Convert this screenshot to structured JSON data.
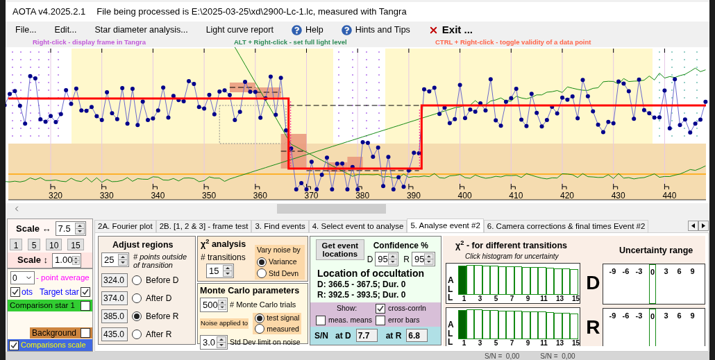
{
  "window": {
    "app_version": "AOTA v4.2025.2.1",
    "file_info": "File being processed is E:\\2025-03-25\\xd\\2900-Lc-1.lc, measured with Tangra"
  },
  "menu": [
    {
      "label": "File...",
      "kind": "plain"
    },
    {
      "label": "Edit...",
      "kind": "plain"
    },
    {
      "label": "Star diameter analysis...",
      "kind": "plain"
    },
    {
      "label": "Light curve report",
      "kind": "plain"
    },
    {
      "label": "Help",
      "kind": "help"
    },
    {
      "label": "Hints and Tips",
      "kind": "help"
    },
    {
      "label": "Exit ...",
      "kind": "exit"
    }
  ],
  "hints": [
    {
      "text": "Right-click  -  display frame in Tangra",
      "color": "#c058d8"
    },
    {
      "text": "ALT + Right-click  -  set full light level",
      "color": "#2e8b57"
    },
    {
      "text": "CTRL + Right-click  -  toggle validity of a data point",
      "color": "#ff6347"
    }
  ],
  "plot": {
    "x_tick_labels": [
      "320",
      "330",
      "340",
      "350",
      "360",
      "370",
      "380",
      "390",
      "400",
      "410",
      "420",
      "430",
      "440"
    ]
  },
  "scale_panel": {
    "horizontal": {
      "label": "Scale ↔",
      "value": "7.5"
    },
    "presets": [
      "1",
      "5",
      "10",
      "15"
    ],
    "vertical": {
      "label": "Scale ↕",
      "value": "1.00"
    }
  },
  "series_panel": {
    "average": {
      "value": "0",
      "label": "- point average"
    },
    "series": [
      {
        "kind": "target",
        "prefix_label": "ots",
        "prefix_checked": true,
        "label": "Target star",
        "checked": true,
        "color": "#0000ff"
      },
      {
        "kind": "comparison",
        "label": "Comparison star 1",
        "checked": false,
        "color": "#32cd32"
      },
      {
        "kind": "background",
        "label": "Background",
        "checked": false,
        "color": "#cd853f"
      },
      {
        "kind": "scaled",
        "label": "Comparisons scale",
        "checked": true,
        "color": "#4169e1"
      }
    ]
  },
  "tabs": [
    {
      "label": "2A. Fourier plot",
      "selected": false
    },
    {
      "label": "2B. [1, 2 & 3] - frame test",
      "selected": false
    },
    {
      "label": "3. Find events",
      "selected": false
    },
    {
      "label": "4. Select event to analyse",
      "selected": false
    },
    {
      "label": "5. Analyse event #2",
      "selected": true
    },
    {
      "label": "6. Camera corrections & final times Event #2",
      "selected": false
    }
  ],
  "adjust_regions": {
    "title": "Adjust regions",
    "points": {
      "value": "25",
      "label": "# points outside of transition"
    },
    "regions": [
      {
        "value": "324.0",
        "label": "Before D",
        "selected": false
      },
      {
        "value": "374.0",
        "label": "After D",
        "selected": false
      },
      {
        "value": "385.0",
        "label": "Before R",
        "selected": true
      },
      {
        "value": "435.0",
        "label": "After R",
        "selected": false
      }
    ]
  },
  "chi2_analysis": {
    "title": "χ$^{2}$ analysis",
    "transitions": {
      "label": "# transitions",
      "value": "15"
    },
    "vary_noise": {
      "title": "Vary noise by",
      "options": [
        {
          "label": "Variance",
          "selected": true
        },
        {
          "label": "Std Devn",
          "selected": false
        }
      ]
    }
  },
  "monte_carlo": {
    "title": "Monte Carlo parameters",
    "trials": {
      "value": "500",
      "label": "# Monte Carlo trials"
    },
    "noise_applied_label": "Noise applied to",
    "noise_options": [
      {
        "label": "test signal",
        "selected": true
      },
      {
        "label": "measured",
        "selected": false
      }
    ],
    "std_dev": {
      "value": "3.0",
      "label": "Std Dev limit on noise"
    }
  },
  "event_locations": {
    "button": "Get event locations",
    "confidence": {
      "title": "Confidence %",
      "d": {
        "label": "D",
        "value": "95"
      },
      "r": {
        "label": "R",
        "value": "95"
      }
    },
    "location_title": "Location of occultation",
    "lines": [
      "D: 366.5 - 367.5; Dur. 0",
      "R: 392.5 - 393.5; Dur. 0"
    ],
    "show": {
      "title": "Show:",
      "options": [
        {
          "label": "cross-corrln",
          "checked": true
        },
        {
          "label": "meas. means",
          "checked": false
        },
        {
          "label": "error bars",
          "checked": false
        }
      ]
    },
    "sn": {
      "label": "S/N",
      "d_label": "at D",
      "d_value": "7.7",
      "r_label": "at R",
      "r_value": "6.8"
    }
  },
  "transitions_chart": {
    "title": "χ$^{2}$ - for different transitions",
    "subtitle": "Click histogram for uncertainty",
    "histograms": [
      {
        "side_label": "ALL",
        "letter": "D",
        "bar_labels": [
          "1",
          "3",
          "5",
          "7",
          "9",
          "11",
          "13",
          "15"
        ]
      },
      {
        "side_label": "ALL",
        "letter": "R",
        "bar_labels": [
          "1",
          "3",
          "5",
          "7",
          "9",
          "11",
          "13",
          "15"
        ]
      }
    ]
  },
  "uncertainty": {
    "title": "Uncertainty range",
    "panels": [
      {
        "ticks": [
          "-9",
          "-6",
          "-3",
          "0",
          "3",
          "6",
          "9"
        ]
      },
      {
        "ticks": [
          "-9",
          "-6",
          "-3",
          "0",
          "3",
          "6",
          "9"
        ]
      }
    ]
  },
  "background_window": {
    "texts": [
      "S/N =  0,00",
      "S/N =  0,00"
    ]
  }
}
